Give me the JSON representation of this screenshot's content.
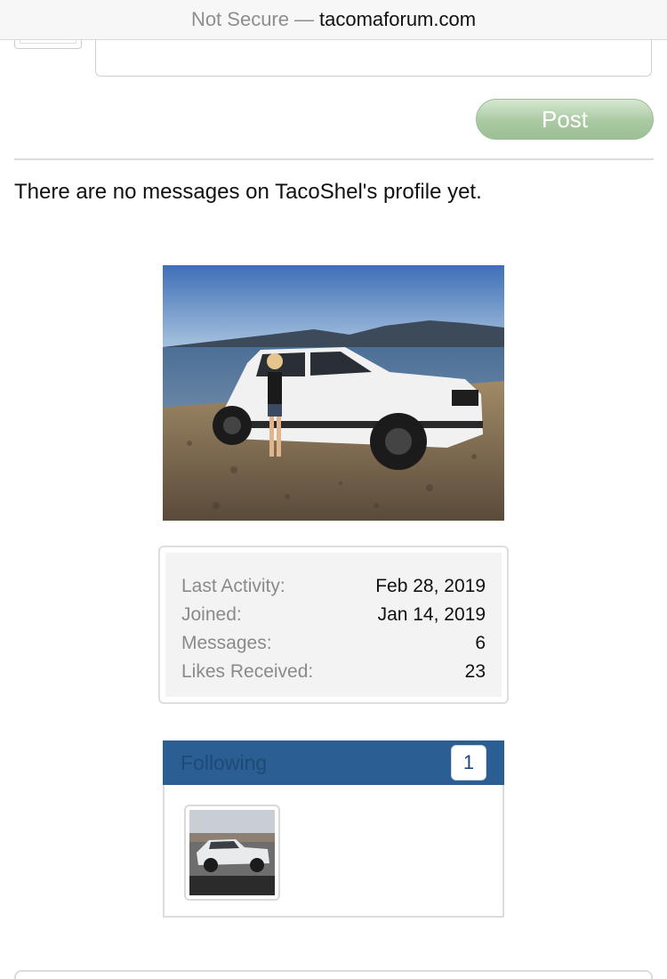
{
  "browser": {
    "security_label": "Not Secure",
    "separator": "—",
    "domain": "tacomaforum.com"
  },
  "composer": {
    "post_label": "Post"
  },
  "profile": {
    "no_messages_text": "There are no messages on TacoShel's profile yet."
  },
  "stats": [
    {
      "label": "Last Activity:",
      "value": "Feb 28, 2019"
    },
    {
      "label": "Joined:",
      "value": "Jan 14, 2019"
    },
    {
      "label": "Messages:",
      "value": "6"
    },
    {
      "label": "Likes Received:",
      "value": "23"
    }
  ],
  "following": {
    "title": "Following",
    "count": "1"
  },
  "colors": {
    "header_blue": "#2b5e92",
    "post_button_green": "#a9c9a2"
  }
}
